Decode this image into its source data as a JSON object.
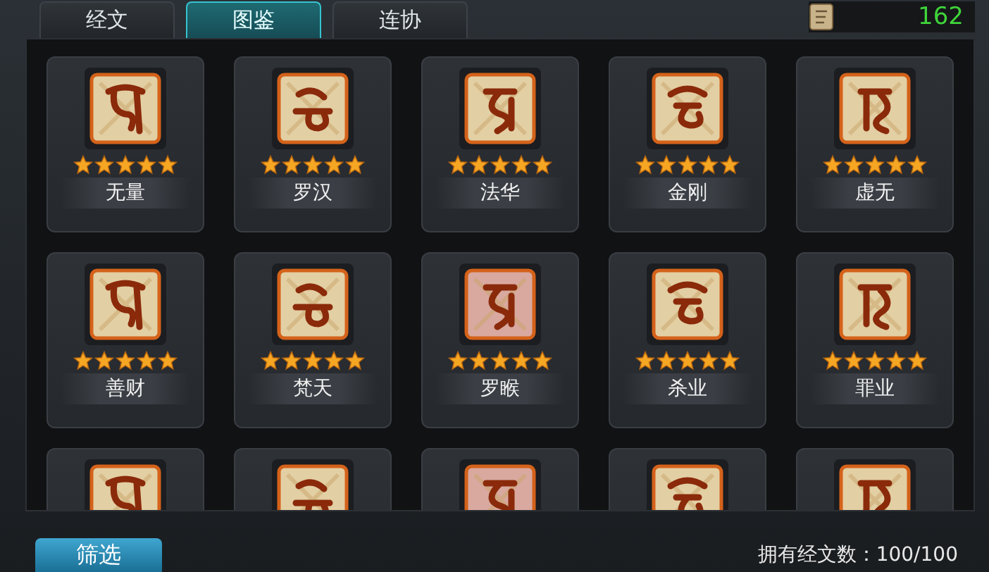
{
  "tabs": [
    {
      "label": "经文",
      "selected": false
    },
    {
      "label": "图鉴",
      "selected": true
    },
    {
      "label": "连协",
      "selected": false
    }
  ],
  "currency": {
    "amount": "162"
  },
  "cards": [
    {
      "kind": "full",
      "name": "无量",
      "stars": 5
    },
    {
      "kind": "full",
      "name": "罗汉",
      "stars": 5
    },
    {
      "kind": "full",
      "name": "法华",
      "stars": 5
    },
    {
      "kind": "full",
      "name": "金刚",
      "stars": 5
    },
    {
      "kind": "full",
      "name": "虚无",
      "stars": 5
    },
    {
      "kind": "full",
      "name": "善财",
      "stars": 5
    },
    {
      "kind": "full",
      "name": "梵天",
      "stars": 5
    },
    {
      "kind": "full",
      "name": "罗睺",
      "stars": 5
    },
    {
      "kind": "full",
      "name": "杀业",
      "stars": 5
    },
    {
      "kind": "full",
      "name": "罪业",
      "stars": 5
    },
    {
      "kind": "clipped"
    },
    {
      "kind": "clipped"
    },
    {
      "kind": "clipped"
    },
    {
      "kind": "clipped"
    },
    {
      "kind": "clipped"
    }
  ],
  "filter_button": "筛选",
  "owned_count": "拥有经文数：100/100"
}
